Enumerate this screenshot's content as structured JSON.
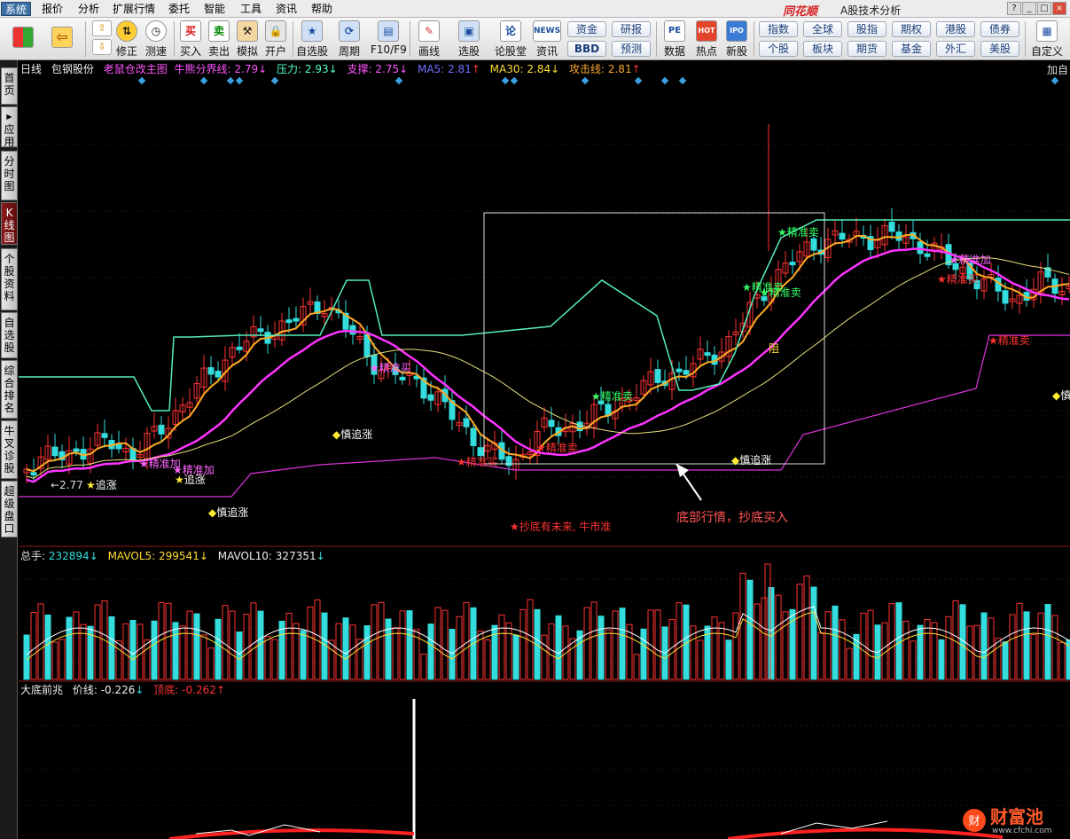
{
  "menubar": {
    "items": [
      "系统",
      "报价",
      "分析",
      "扩展行情",
      "委托",
      "智能",
      "工具",
      "资讯",
      "帮助"
    ],
    "brand": "同花顺",
    "subtitle": "A股技术分析"
  },
  "toolbar": {
    "buttons": [
      {
        "label": "修正",
        "icon": "up-down-arrow-icon"
      },
      {
        "label": "测速",
        "icon": "clock-icon"
      },
      {
        "label": "买入",
        "glyph": "买",
        "icon": "buy-icon"
      },
      {
        "label": "卖出",
        "glyph": "卖",
        "icon": "sell-icon"
      },
      {
        "label": "模拟",
        "icon": "gavel-icon"
      },
      {
        "label": "开户",
        "icon": "lock-icon"
      },
      {
        "label": "自选股",
        "icon": "star-icon"
      },
      {
        "label": "周期",
        "icon": "cycle-icon"
      },
      {
        "label": "F10/F9",
        "icon": "f10-icon"
      },
      {
        "label": "画线",
        "icon": "pencil-icon"
      },
      {
        "label": "选股",
        "icon": "screen-icon"
      },
      {
        "label": "论股堂",
        "glyph": "论",
        "icon": "forum-icon"
      },
      {
        "label": "资讯",
        "glyph": "NEWS",
        "icon": "news-icon"
      },
      {
        "label": "数据",
        "glyph": "PE",
        "icon": "data-icon"
      },
      {
        "label": "热点",
        "glyph": "HOT",
        "icon": "hot-icon"
      },
      {
        "label": "新股",
        "glyph": "IPO",
        "icon": "ipo-icon"
      },
      {
        "label": "自定义",
        "icon": "custom-icon"
      }
    ],
    "pills": [
      "资金",
      "研报",
      "BBD",
      "预测",
      "指数",
      "全球",
      "股指",
      "期权",
      "港股",
      "债券",
      "个股",
      "板块",
      "期货",
      "基金",
      "外汇",
      "美股"
    ]
  },
  "sidebar": {
    "tabs": [
      "首页",
      "应用",
      "分时图",
      "K线图",
      "个股资料",
      "自选股",
      "综合排名",
      "牛叉诊股",
      "超级盘口"
    ],
    "active": "K线图"
  },
  "main_header": {
    "period": "日线",
    "stock": "包钢股份",
    "indicator_name": "老鼠仓改主图",
    "items": [
      {
        "label": "牛熊分界线:",
        "value": "2.79",
        "dir": "↓",
        "color": "#ff55ff"
      },
      {
        "label": "压力:",
        "value": "2.93",
        "dir": "↓",
        "color": "#55ffcc"
      },
      {
        "label": "支撑:",
        "value": "2.75",
        "dir": "↓",
        "color": "#ff55ff"
      },
      {
        "label": "MA5:",
        "value": "2.81",
        "dir": "↑",
        "color": "#6f6fff"
      },
      {
        "label": "MA30:",
        "value": "2.84",
        "dir": "↓",
        "color": "#ffdd33"
      },
      {
        "label": "攻击线:",
        "value": "2.81",
        "dir": "↑",
        "color": "#ffaa33"
      }
    ],
    "right_label": "加自"
  },
  "annotations": {
    "price_low": "←2.77",
    "zhui_zhang": "追涨",
    "jing_zhun_jia": "精准加",
    "jing_zhun_mai": "精准买",
    "jing_zhun_sell": "精准卖",
    "shen_zhui": "慎追涨",
    "chao_di": "抄底有未来, 牛市准",
    "callout": "底部行情，抄底买入",
    "zu": "阻",
    "shen_zhui_right": "慎"
  },
  "volume_header": {
    "items": [
      {
        "label": "总手:",
        "value": "232894",
        "dir": "↓",
        "color": "#33dddd"
      },
      {
        "label": "MAVOL5:",
        "value": "299541",
        "dir": "↓",
        "color": "#ffdd33"
      },
      {
        "label": "MAVOL10:",
        "value": "327351",
        "dir": "↓",
        "color": "#eeeeee"
      }
    ]
  },
  "lower_header": {
    "name": "大底前兆",
    "items": [
      {
        "label": "价线:",
        "value": "-0.226",
        "dir": "↓",
        "color": "#eeeeee"
      },
      {
        "label": "顶底:",
        "value": "-0.262",
        "dir": "↑",
        "color": "#ff3333"
      }
    ]
  },
  "watermark": {
    "name": "财富池",
    "url": "www.cfchi.com"
  },
  "colors": {
    "up": "#ff3333",
    "down": "#33dddd",
    "ma_orange": "#ffaa22",
    "ma_yellow": "#e8e07a",
    "support": "#ff33ff",
    "pressure": "#55eebb",
    "signal_box": "#dddddd"
  }
}
